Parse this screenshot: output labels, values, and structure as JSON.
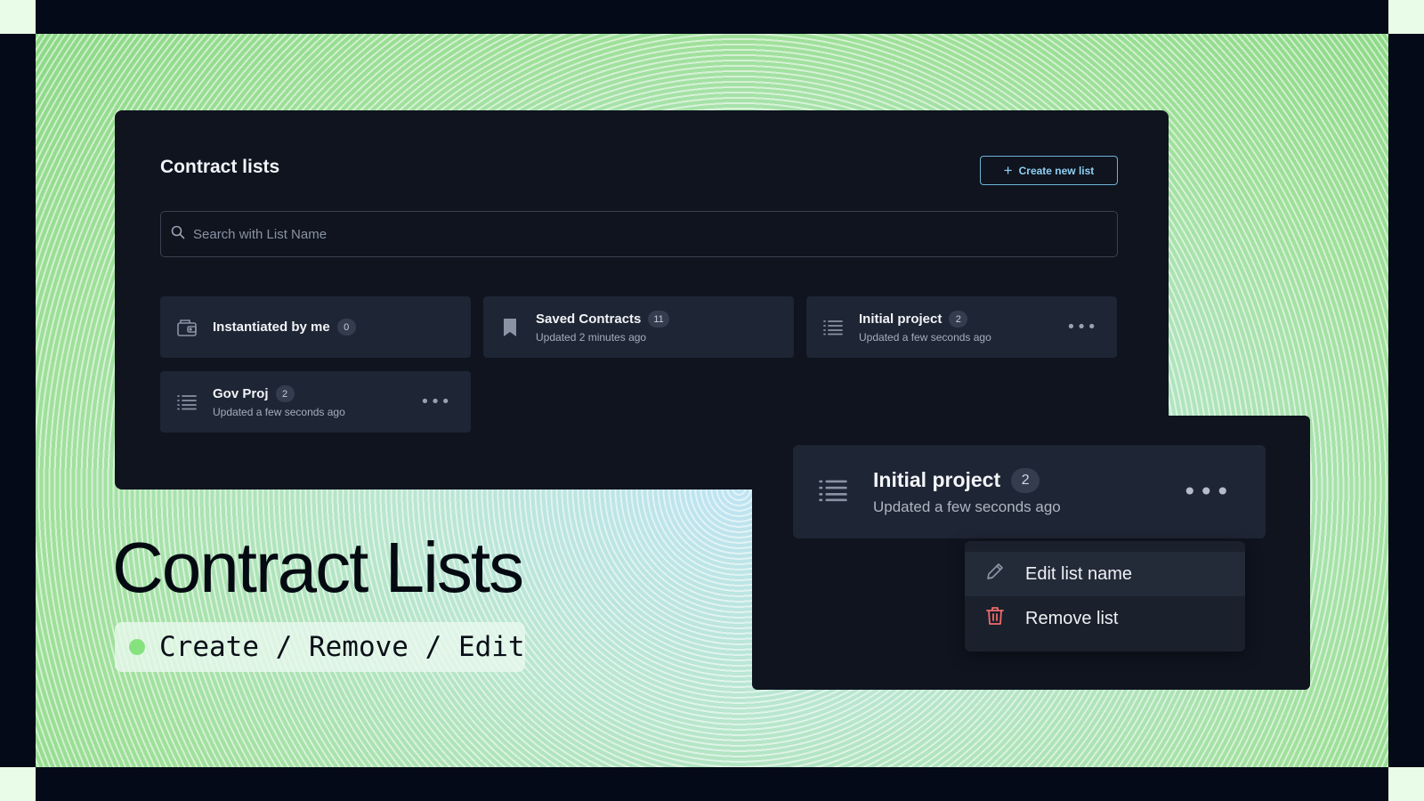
{
  "panel": {
    "title": "Contract lists",
    "create_button": "Create new list",
    "search": {
      "placeholder": "Search with List Name",
      "value": ""
    },
    "cards": [
      {
        "name": "Instantiated by me",
        "count": "0",
        "updated": "",
        "icon": "folder-icon"
      },
      {
        "name": "Saved Contracts",
        "count": "11",
        "updated": "Updated 2 minutes ago",
        "icon": "bookmark-icon"
      },
      {
        "name": "Initial project",
        "count": "2",
        "updated": "Updated a few seconds ago",
        "icon": "list-icon"
      },
      {
        "name": "Gov Proj",
        "count": "2",
        "updated": "Updated a few seconds ago",
        "icon": "list-icon"
      }
    ]
  },
  "zoom": {
    "card": {
      "name": "Initial project",
      "count": "2",
      "updated": "Updated a few seconds ago",
      "icon": "list-icon"
    },
    "menu": [
      {
        "label": "Edit list name",
        "icon": "pencil-icon"
      },
      {
        "label": "Remove list",
        "icon": "trash-icon",
        "color": "#f06b6b"
      }
    ]
  },
  "hero": {
    "title": "Contract Lists",
    "tagline": "Create / Remove / Edit",
    "dot_color": "#86e27f"
  },
  "colors": {
    "accent": "#8fd0f2",
    "panel_bg": "#0f141f",
    "card_bg": "#1e2534"
  }
}
